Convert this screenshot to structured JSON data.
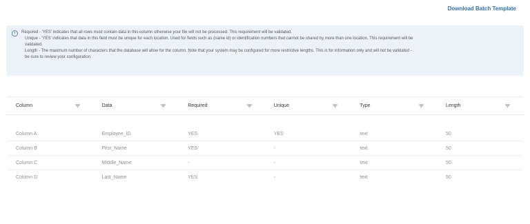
{
  "header": {
    "download_label": "Download Batch Template"
  },
  "info": {
    "icon": "info-circle-icon",
    "lines": [
      "Required - 'YES' indicates that all rows must contain data in this column otherwise your file will not be processed. This requirement will be validated.",
      "Unique - 'YES' indicates that data in this field must be unique for each location. Used for fields such as (name id) or identification numbers that cannot be shared by more than one location. This requirement will be",
      "validated.",
      "Length - The maximum number of characters that the database will allow for the column. Note that your system may be configured for more restrictive lengths. This is for information only and will not be validated -",
      "be sure to review your configuration."
    ]
  },
  "table": {
    "columns": [
      "Column",
      "Data",
      "Required",
      "Unique",
      "Type",
      "Length"
    ],
    "rows": [
      [
        "Column A",
        "Employee_ID",
        "YES",
        "YES",
        "text",
        "50"
      ],
      [
        "Column B",
        "First_Name",
        "YES",
        "-",
        "text",
        "50"
      ],
      [
        "Column C",
        "Middle_Name",
        "-",
        "-",
        "text",
        "50"
      ],
      [
        "Column D",
        "Last_Name",
        "YES",
        "-",
        "text",
        "50"
      ]
    ]
  },
  "colors": {
    "link": "#2f6db5",
    "info_bg": "#edf2f9",
    "info_icon": "#5a7fb4"
  }
}
